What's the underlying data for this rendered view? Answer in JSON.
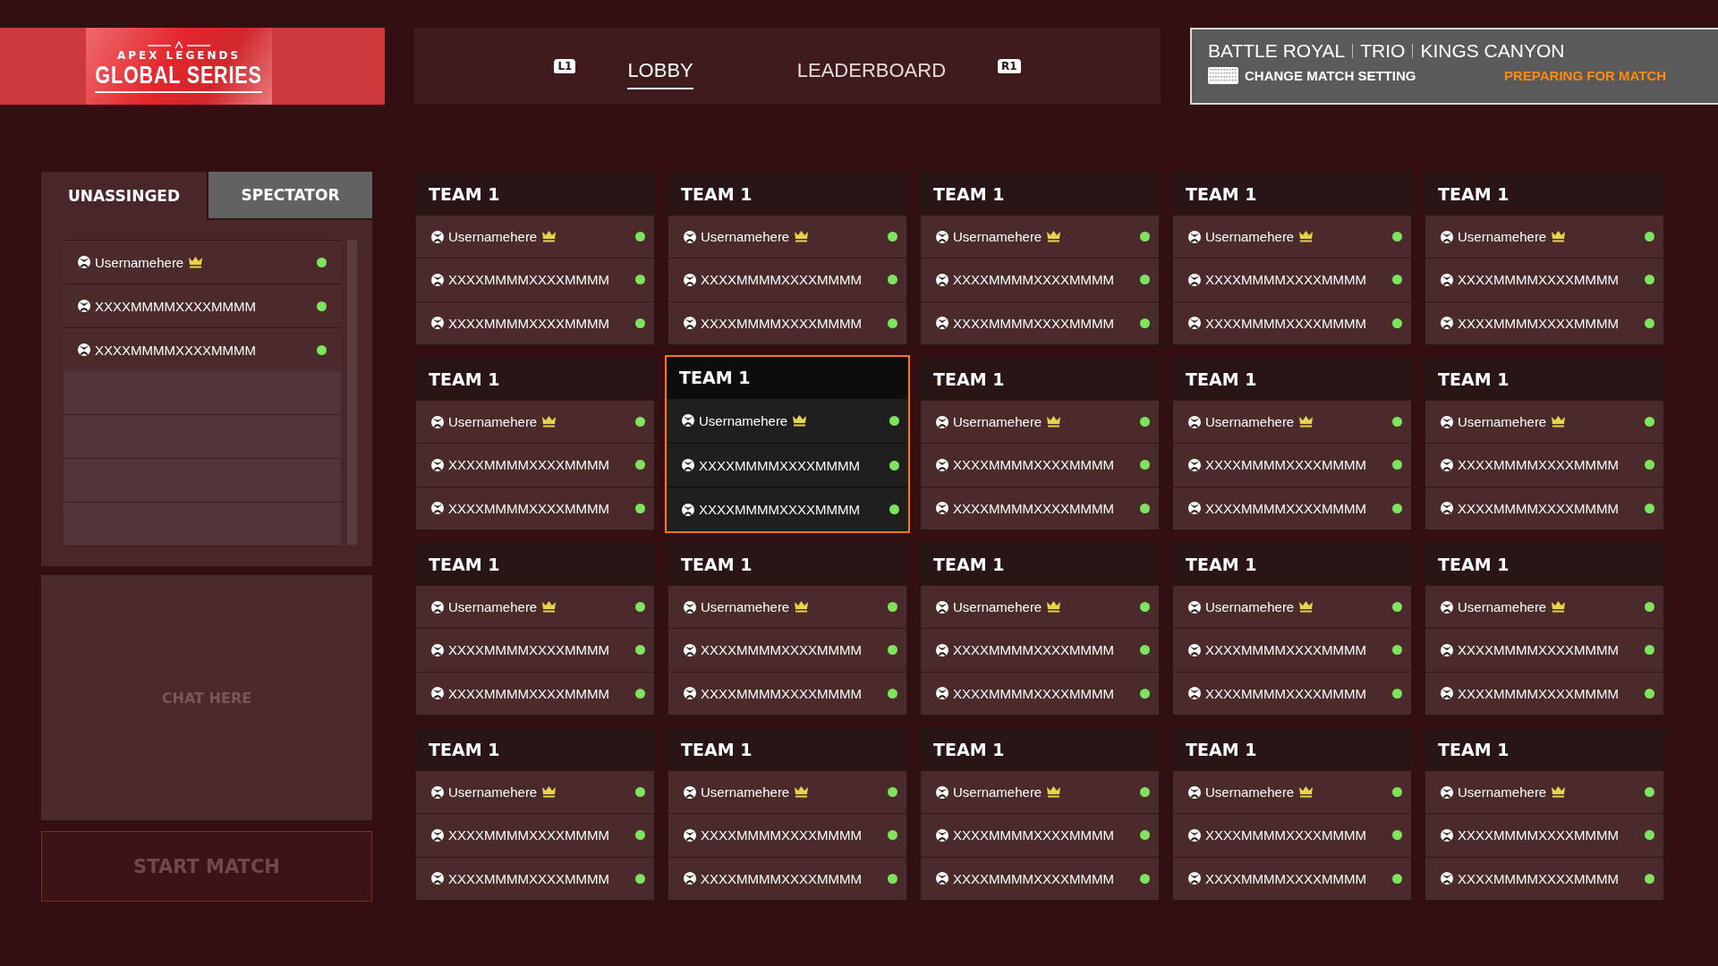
{
  "logo": {
    "top": "APEX LEGENDS",
    "main": "GLOBAL SERIES"
  },
  "nav": {
    "prev_key": "L1",
    "next_key": "R1",
    "tabs": [
      {
        "label": "LOBBY",
        "selected": true
      },
      {
        "label": "LEADERBOARD",
        "selected": false
      }
    ]
  },
  "match": {
    "modes": [
      "BATTLE ROYAL",
      "TRIO",
      "KINGS CANYON"
    ],
    "change_setting": "CHANGE MATCH SETTING",
    "status": "PREPARING FOR MATCH"
  },
  "side_tabs": [
    {
      "label": "UNASSINGED",
      "selected": true
    },
    {
      "label": "SPECTATOR",
      "selected": false
    }
  ],
  "unassigned": [
    {
      "name": "Usernamehere",
      "leader": true,
      "online": true
    },
    {
      "name": "XXXXMMMMXXXXMMMM",
      "leader": false,
      "online": true
    },
    {
      "name": "XXXXMMMMXXXXMMMM",
      "leader": false,
      "online": true
    }
  ],
  "chat": {
    "placeholder": "CHAT HERE"
  },
  "start_button": {
    "label": "START MATCH",
    "disabled": true
  },
  "teams": [
    {
      "name": "TEAM 1",
      "selected": false,
      "players": [
        {
          "name": "Usernamehere",
          "leader": true,
          "online": true
        },
        {
          "name": "XXXXMMMMXXXXMMMM",
          "leader": false,
          "online": true
        },
        {
          "name": "XXXXMMMMXXXXMMMM",
          "leader": false,
          "online": true
        }
      ]
    },
    {
      "name": "TEAM 1",
      "selected": false,
      "players": [
        {
          "name": "Usernamehere",
          "leader": true,
          "online": true
        },
        {
          "name": "XXXXMMMMXXXXMMMM",
          "leader": false,
          "online": true
        },
        {
          "name": "XXXXMMMMXXXXMMMM",
          "leader": false,
          "online": true
        }
      ]
    },
    {
      "name": "TEAM 1",
      "selected": false,
      "players": [
        {
          "name": "Usernamehere",
          "leader": true,
          "online": true
        },
        {
          "name": "XXXXMMMMXXXXMMMM",
          "leader": false,
          "online": true
        },
        {
          "name": "XXXXMMMMXXXXMMMM",
          "leader": false,
          "online": true
        }
      ]
    },
    {
      "name": "TEAM 1",
      "selected": false,
      "players": [
        {
          "name": "Usernamehere",
          "leader": true,
          "online": true
        },
        {
          "name": "XXXXMMMMXXXXMMMM",
          "leader": false,
          "online": true
        },
        {
          "name": "XXXXMMMMXXXXMMMM",
          "leader": false,
          "online": true
        }
      ]
    },
    {
      "name": "TEAM 1",
      "selected": false,
      "players": [
        {
          "name": "Usernamehere",
          "leader": true,
          "online": true
        },
        {
          "name": "XXXXMMMMXXXXMMMM",
          "leader": false,
          "online": true
        },
        {
          "name": "XXXXMMMMXXXXMMMM",
          "leader": false,
          "online": true
        }
      ]
    },
    {
      "name": "TEAM 1",
      "selected": false,
      "players": [
        {
          "name": "Usernamehere",
          "leader": true,
          "online": true
        },
        {
          "name": "XXXXMMMMXXXXMMMM",
          "leader": false,
          "online": true
        },
        {
          "name": "XXXXMMMMXXXXMMMM",
          "leader": false,
          "online": true
        }
      ]
    },
    {
      "name": "TEAM 1",
      "selected": true,
      "players": [
        {
          "name": "Usernamehere",
          "leader": true,
          "online": true
        },
        {
          "name": "XXXXMMMMXXXXMMMM",
          "leader": false,
          "online": true
        },
        {
          "name": "XXXXMMMMXXXXMMMM",
          "leader": false,
          "online": true
        }
      ]
    },
    {
      "name": "TEAM 1",
      "selected": false,
      "players": [
        {
          "name": "Usernamehere",
          "leader": true,
          "online": true
        },
        {
          "name": "XXXXMMMMXXXXMMMM",
          "leader": false,
          "online": true
        },
        {
          "name": "XXXXMMMMXXXXMMMM",
          "leader": false,
          "online": true
        }
      ]
    },
    {
      "name": "TEAM 1",
      "selected": false,
      "players": [
        {
          "name": "Usernamehere",
          "leader": true,
          "online": true
        },
        {
          "name": "XXXXMMMMXXXXMMMM",
          "leader": false,
          "online": true
        },
        {
          "name": "XXXXMMMMXXXXMMMM",
          "leader": false,
          "online": true
        }
      ]
    },
    {
      "name": "TEAM 1",
      "selected": false,
      "players": [
        {
          "name": "Usernamehere",
          "leader": true,
          "online": true
        },
        {
          "name": "XXXXMMMMXXXXMMMM",
          "leader": false,
          "online": true
        },
        {
          "name": "XXXXMMMMXXXXMMMM",
          "leader": false,
          "online": true
        }
      ]
    },
    {
      "name": "TEAM 1",
      "selected": false,
      "players": [
        {
          "name": "Usernamehere",
          "leader": true,
          "online": true
        },
        {
          "name": "XXXXMMMMXXXXMMMM",
          "leader": false,
          "online": true
        },
        {
          "name": "XXXXMMMMXXXXMMMM",
          "leader": false,
          "online": true
        }
      ]
    },
    {
      "name": "TEAM 1",
      "selected": false,
      "players": [
        {
          "name": "Usernamehere",
          "leader": true,
          "online": true
        },
        {
          "name": "XXXXMMMMXXXXMMMM",
          "leader": false,
          "online": true
        },
        {
          "name": "XXXXMMMMXXXXMMMM",
          "leader": false,
          "online": true
        }
      ]
    },
    {
      "name": "TEAM 1",
      "selected": false,
      "players": [
        {
          "name": "Usernamehere",
          "leader": true,
          "online": true
        },
        {
          "name": "XXXXMMMMXXXXMMMM",
          "leader": false,
          "online": true
        },
        {
          "name": "XXXXMMMMXXXXMMMM",
          "leader": false,
          "online": true
        }
      ]
    },
    {
      "name": "TEAM 1",
      "selected": false,
      "players": [
        {
          "name": "Usernamehere",
          "leader": true,
          "online": true
        },
        {
          "name": "XXXXMMMMXXXXMMMM",
          "leader": false,
          "online": true
        },
        {
          "name": "XXXXMMMMXXXXMMMM",
          "leader": false,
          "online": true
        }
      ]
    },
    {
      "name": "TEAM 1",
      "selected": false,
      "players": [
        {
          "name": "Usernamehere",
          "leader": true,
          "online": true
        },
        {
          "name": "XXXXMMMMXXXXMMMM",
          "leader": false,
          "online": true
        },
        {
          "name": "XXXXMMMMXXXXMMMM",
          "leader": false,
          "online": true
        }
      ]
    },
    {
      "name": "TEAM 1",
      "selected": false,
      "players": [
        {
          "name": "Usernamehere",
          "leader": true,
          "online": true
        },
        {
          "name": "XXXXMMMMXXXXMMMM",
          "leader": false,
          "online": true
        },
        {
          "name": "XXXXMMMMXXXXMMMM",
          "leader": false,
          "online": true
        }
      ]
    },
    {
      "name": "TEAM 1",
      "selected": false,
      "players": [
        {
          "name": "Usernamehere",
          "leader": true,
          "online": true
        },
        {
          "name": "XXXXMMMMXXXXMMMM",
          "leader": false,
          "online": true
        },
        {
          "name": "XXXXMMMMXXXXMMMM",
          "leader": false,
          "online": true
        }
      ]
    },
    {
      "name": "TEAM 1",
      "selected": false,
      "players": [
        {
          "name": "Usernamehere",
          "leader": true,
          "online": true
        },
        {
          "name": "XXXXMMMMXXXXMMMM",
          "leader": false,
          "online": true
        },
        {
          "name": "XXXXMMMMXXXXMMMM",
          "leader": false,
          "online": true
        }
      ]
    },
    {
      "name": "TEAM 1",
      "selected": false,
      "players": [
        {
          "name": "Usernamehere",
          "leader": true,
          "online": true
        },
        {
          "name": "XXXXMMMMXXXXMMMM",
          "leader": false,
          "online": true
        },
        {
          "name": "XXXXMMMMXXXXMMMM",
          "leader": false,
          "online": true
        }
      ]
    },
    {
      "name": "TEAM 1",
      "selected": false,
      "players": [
        {
          "name": "Usernamehere",
          "leader": true,
          "online": true
        },
        {
          "name": "XXXXMMMMXXXXMMMM",
          "leader": false,
          "online": true
        },
        {
          "name": "XXXXMMMMXXXXMMMM",
          "leader": false,
          "online": true
        }
      ]
    }
  ]
}
